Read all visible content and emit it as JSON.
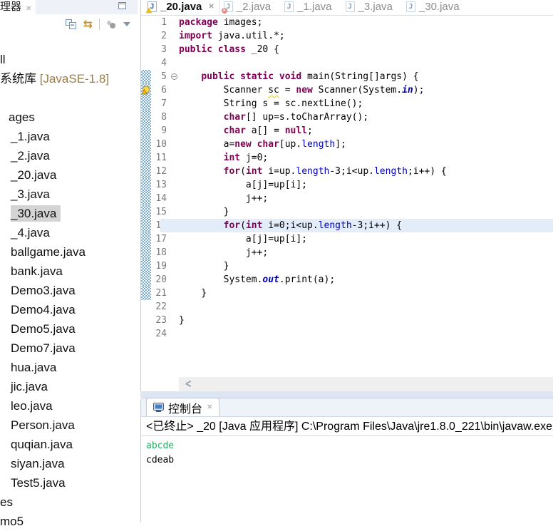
{
  "colors": {
    "keyword": "#7F0055",
    "field_blue": "#0000C0",
    "current_line": "#E3EDFA",
    "selection_gray": "#D4D4D4",
    "range_hatch_blue": "#79ABD2",
    "library_deco": "#9C7C44",
    "console_stdin_green": "#2AA962",
    "warning_yellow": "#F2C200",
    "error_red": "#CF3B3B"
  },
  "icons": {
    "close": "✕",
    "link_with_editor": "⇆",
    "scroll_left": "<",
    "java_file_letter": "J",
    "error_x": "✕",
    "front_square_minus": "−"
  },
  "explorer": {
    "tab_title": "理器",
    "items": [
      {
        "label": "ll",
        "indent": 0
      },
      {
        "label": "系统库 ",
        "deco": "[JavaSE-1.8]",
        "indent": 0
      },
      {
        "label": "",
        "indent": 0
      },
      {
        "label": "ages",
        "indent": 12
      },
      {
        "label": "_1.java",
        "indent": 15
      },
      {
        "label": "_2.java",
        "indent": 15
      },
      {
        "label": "_20.java",
        "indent": 15
      },
      {
        "label": "_3.java",
        "indent": 15
      },
      {
        "label": "_30.java",
        "indent": 15,
        "selected": true
      },
      {
        "label": "_4.java",
        "indent": 15
      },
      {
        "label": "ballgame.java",
        "indent": 15
      },
      {
        "label": "bank.java",
        "indent": 15
      },
      {
        "label": "Demo3.java",
        "indent": 15
      },
      {
        "label": "Demo4.java",
        "indent": 15
      },
      {
        "label": "Demo5.java",
        "indent": 15
      },
      {
        "label": "Demo7.java",
        "indent": 15
      },
      {
        "label": "hua.java",
        "indent": 15
      },
      {
        "label": "jic.java",
        "indent": 15
      },
      {
        "label": "leo.java",
        "indent": 15
      },
      {
        "label": "Person.java",
        "indent": 15
      },
      {
        "label": "quqian.java",
        "indent": 15
      },
      {
        "label": "siyan.java",
        "indent": 15
      },
      {
        "label": "Test5.java",
        "indent": 15
      },
      {
        "label": "es",
        "indent": 0
      },
      {
        "label": "mo5",
        "indent": 0
      }
    ]
  },
  "editor": {
    "tabs": [
      {
        "label": "_20.java",
        "active": true,
        "overlay": "warning",
        "close": true
      },
      {
        "label": "_2.java",
        "overlay": "error"
      },
      {
        "label": "_1.java"
      },
      {
        "label": "_3.java"
      },
      {
        "label": "_30.java"
      }
    ],
    "active_line": 16,
    "fold_line": 5,
    "warning_line": 6,
    "range_start": 5,
    "range_end": 21,
    "lines": [
      [
        [
          "k",
          "package"
        ],
        [
          "p",
          " images;"
        ]
      ],
      [
        [
          "k",
          "import"
        ],
        [
          "p",
          " java.util.*;"
        ]
      ],
      [
        [
          "k",
          "public"
        ],
        [
          "p",
          " "
        ],
        [
          "k",
          "class"
        ],
        [
          "p",
          " _20 {"
        ]
      ],
      [],
      [
        [
          "p",
          "    "
        ],
        [
          "k",
          "public"
        ],
        [
          "p",
          " "
        ],
        [
          "k",
          "static"
        ],
        [
          "p",
          " "
        ],
        [
          "k",
          "void"
        ],
        [
          "p",
          " main(String[]args) {"
        ]
      ],
      [
        [
          "p",
          "        Scanner "
        ],
        [
          "w",
          "sc"
        ],
        [
          "p",
          " = "
        ],
        [
          "k",
          "new"
        ],
        [
          "p",
          " Scanner(System."
        ],
        [
          "sf",
          "in"
        ],
        [
          "p",
          ");"
        ]
      ],
      [
        [
          "p",
          "        String s = sc.nextLine();"
        ]
      ],
      [
        [
          "p",
          "        "
        ],
        [
          "k",
          "char"
        ],
        [
          "p",
          "[] up=s.toCharArray();"
        ]
      ],
      [
        [
          "p",
          "        "
        ],
        [
          "k",
          "char"
        ],
        [
          "p",
          " a[] = "
        ],
        [
          "k",
          "null"
        ],
        [
          "p",
          ";"
        ]
      ],
      [
        [
          "p",
          "        a="
        ],
        [
          "k",
          "new"
        ],
        [
          "p",
          " "
        ],
        [
          "k",
          "char"
        ],
        [
          "p",
          "[up."
        ],
        [
          "f",
          "length"
        ],
        [
          "p",
          "];"
        ]
      ],
      [
        [
          "p",
          "        "
        ],
        [
          "k",
          "int"
        ],
        [
          "p",
          " j=0;"
        ]
      ],
      [
        [
          "p",
          "        "
        ],
        [
          "k",
          "for"
        ],
        [
          "p",
          "("
        ],
        [
          "k",
          "int"
        ],
        [
          "p",
          " i=up."
        ],
        [
          "f",
          "length"
        ],
        [
          "p",
          "-3;i<up."
        ],
        [
          "f",
          "length"
        ],
        [
          "p",
          ";i++) {"
        ]
      ],
      [
        [
          "p",
          "            a[j]=up[i];"
        ]
      ],
      [
        [
          "p",
          "            j++;"
        ]
      ],
      [
        [
          "p",
          "        }"
        ]
      ],
      [
        [
          "p",
          "        "
        ],
        [
          "k",
          "for"
        ],
        [
          "p",
          "("
        ],
        [
          "k",
          "int"
        ],
        [
          "p",
          " i=0;i<up."
        ],
        [
          "f",
          "length"
        ],
        [
          "p",
          "-3;i++) {"
        ]
      ],
      [
        [
          "p",
          "            a[j]=up[i];"
        ]
      ],
      [
        [
          "p",
          "            j++;"
        ]
      ],
      [
        [
          "p",
          "        }"
        ]
      ],
      [
        [
          "p",
          "        System."
        ],
        [
          "sf",
          "out"
        ],
        [
          "p",
          ".print(a);"
        ]
      ],
      [
        [
          "p",
          "    }"
        ]
      ],
      [],
      [
        [
          "p",
          "}"
        ]
      ],
      []
    ]
  },
  "console": {
    "tab_label": "控制台",
    "status": "<已终止> _20 [Java 应用程序] C:\\Program Files\\Java\\jre1.8.0_221\\bin\\javaw.exe",
    "output": [
      {
        "text": "abcde",
        "stream": "stdin"
      },
      {
        "text": "cdeab",
        "stream": "stdout"
      }
    ]
  }
}
